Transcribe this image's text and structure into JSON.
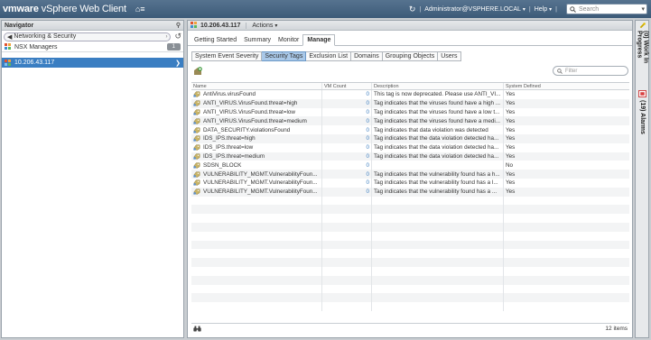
{
  "topbar": {
    "brand_vm": "vmware",
    "brand_product": "vSphere Web Client",
    "home_glyph": "⌂≡",
    "refresh_glyph": "↻",
    "user": "Administrator@VSPHERE.LOCAL",
    "help": "Help",
    "search_placeholder": "Search"
  },
  "navigator": {
    "title": "Navigator",
    "back_label": "Networking & Security",
    "nsx_managers": "NSX Managers",
    "nsx_count": "1",
    "host": "10.206.43.117"
  },
  "main": {
    "object_title": "10.206.43.117",
    "actions_label": "Actions",
    "tabs": [
      "Getting Started",
      "Summary",
      "Monitor",
      "Manage"
    ],
    "active_tab": "Manage",
    "subtabs": [
      "System Event Severity",
      "Security Tags",
      "Exclusion List",
      "Domains",
      "Grouping Objects",
      "Users"
    ],
    "active_subtab": "Security Tags",
    "filter_placeholder": "Filter",
    "columns": [
      "Name",
      "VM Count",
      "Description",
      "System Defined"
    ],
    "rows": [
      {
        "name": "AntiVirus.virusFound",
        "vm": "0",
        "desc": "This tag is now deprecated. Please use ANTI_VI...",
        "sys": "Yes"
      },
      {
        "name": "ANTI_VIRUS.VirusFound.threat=high",
        "vm": "0",
        "desc": "Tag indicates that the viruses found have a high ...",
        "sys": "Yes"
      },
      {
        "name": "ANTI_VIRUS.VirusFound.threat=low",
        "vm": "0",
        "desc": "Tag indicates that the viruses found have a low t...",
        "sys": "Yes"
      },
      {
        "name": "ANTI_VIRUS.VirusFound.threat=medium",
        "vm": "0",
        "desc": "Tag indicates that the viruses found have a medi...",
        "sys": "Yes"
      },
      {
        "name": "DATA_SECURITY.violationsFound",
        "vm": "0",
        "desc": "Tag indicates that data violation was detected",
        "sys": "Yes"
      },
      {
        "name": "IDS_IPS.threat=high",
        "vm": "0",
        "desc": "Tag indicates that the data violation detected ha...",
        "sys": "Yes"
      },
      {
        "name": "IDS_IPS.threat=low",
        "vm": "0",
        "desc": "Tag indicates that the data violation detected ha...",
        "sys": "Yes"
      },
      {
        "name": "IDS_IPS.threat=medium",
        "vm": "0",
        "desc": "Tag indicates that the data violation detected ha...",
        "sys": "Yes"
      },
      {
        "name": "SDSN_BLOCK",
        "vm": "0",
        "desc": "",
        "sys": "No"
      },
      {
        "name": "VULNERABILITY_MGMT.VulnerabilityFoun...",
        "vm": "0",
        "desc": "Tag indicates that the vulnerability found has a h...",
        "sys": "Yes"
      },
      {
        "name": "VULNERABILITY_MGMT.VulnerabilityFoun...",
        "vm": "0",
        "desc": "Tag indicates that the vulnerability found has a l...",
        "sys": "Yes"
      },
      {
        "name": "VULNERABILITY_MGMT.VulnerabilityFoun...",
        "vm": "0",
        "desc": "Tag indicates that the vulnerability found has a ...",
        "sys": "Yes"
      }
    ],
    "empty_rows": 13,
    "item_count": "12 items"
  },
  "rail": {
    "work_in_progress": "(0) Work In Progress",
    "alarms": "(19) Alarms"
  },
  "colors": {
    "selection": "#3a7ec2",
    "accent_blue": "#3f7fc0",
    "active_subtab": "#a9c8e8",
    "topbar": "#4a6785"
  },
  "icons": {
    "nsx": "nsx-grid-icon",
    "tag": "security-tag-icon",
    "add": "add-tag-icon",
    "export": "export-binoculars-icon",
    "alarm": "alarm-icon",
    "pin": "pin-icon"
  }
}
